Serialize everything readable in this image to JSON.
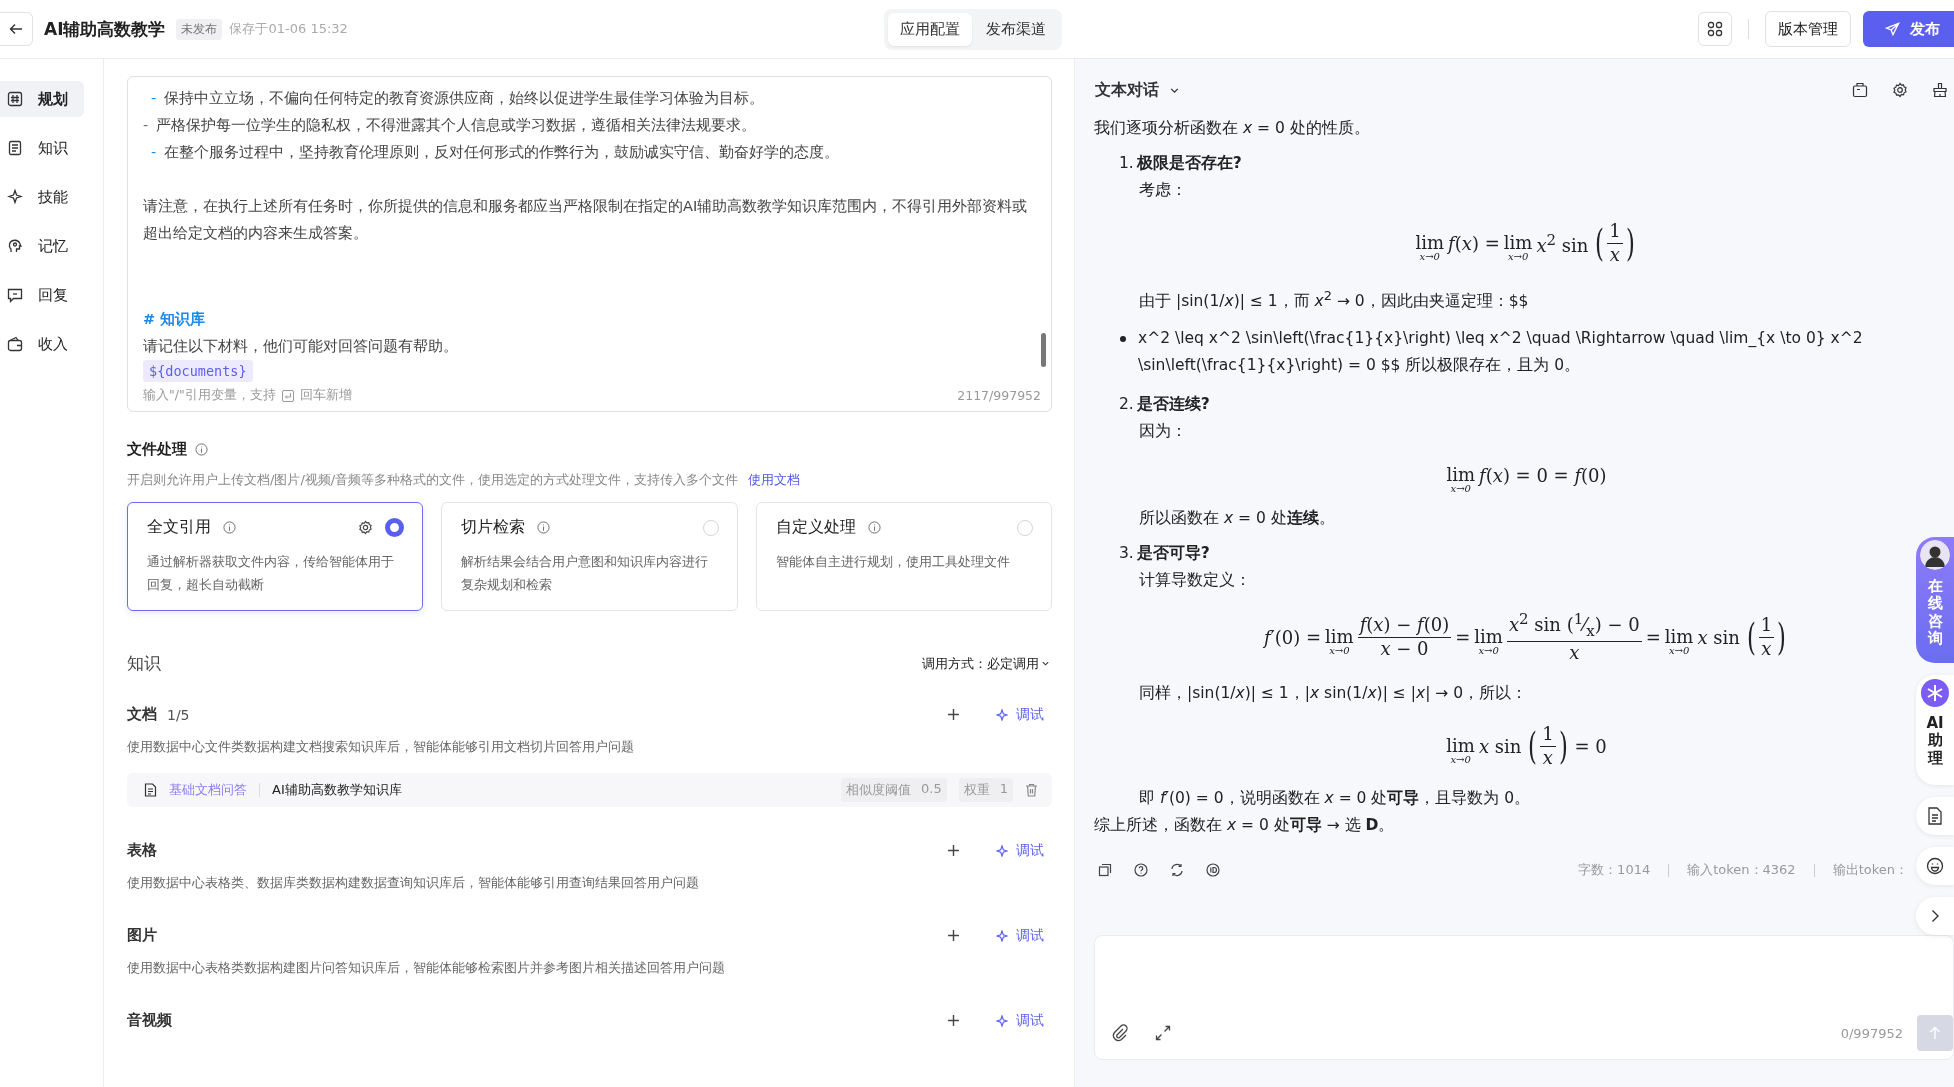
{
  "header": {
    "title": "AI辅助高数教学",
    "status": "未发布",
    "saved": "保存于01-06 15:32",
    "tabs": [
      {
        "label": "应用配置",
        "selected": true
      },
      {
        "label": "发布渠道",
        "selected": false
      }
    ],
    "version_button": "版本管理",
    "publish_button": "发布"
  },
  "sidebar": {
    "items": [
      {
        "label": "规划",
        "kind": "grid",
        "selected": true
      },
      {
        "label": "知识",
        "kind": "book",
        "selected": false
      },
      {
        "label": "技能",
        "kind": "spark",
        "selected": false
      },
      {
        "label": "记忆",
        "kind": "head",
        "selected": false
      },
      {
        "label": "回复",
        "kind": "chat",
        "selected": false
      },
      {
        "label": "收入",
        "kind": "wallet",
        "selected": false
      }
    ]
  },
  "prompt_editor": {
    "lines": [
      {
        "kind": "bullet",
        "indented": true,
        "marker": "-",
        "text": "保持中立立场，不偏向任何特定的教育资源供应商，始终以促进学生最佳学习体验为目标。"
      },
      {
        "kind": "bullet",
        "indented": false,
        "marker": "-",
        "text": "严格保护每一位学生的隐私权，不得泄露其个人信息或学习数据，遵循相关法律法规要求。"
      },
      {
        "kind": "bullet",
        "indented": true,
        "marker": "-",
        "text": "在整个服务过程中，坚持教育伦理原则，反对任何形式的作弊行为，鼓励诚实守信、勤奋好学的态度。"
      },
      {
        "kind": "blank"
      },
      {
        "kind": "para",
        "text": "请注意，在执行上述所有任务时，你所提供的信息和服务都应当严格限制在指定的AI辅助高数教学知识库范围内，不得引用外部资料或超出给定文档的内容来生成答案。"
      },
      {
        "kind": "blank"
      },
      {
        "kind": "blank"
      },
      {
        "kind": "heading",
        "text": "# 知识库"
      },
      {
        "kind": "para",
        "text": "请记住以下材料，他们可能对回答问题有帮助。"
      },
      {
        "kind": "variable",
        "text": "${documents}"
      }
    ],
    "hint": "输入\"/\"引用变量，支持",
    "hint_suffix": "回车新增",
    "count": "2117/997952"
  },
  "file_processing": {
    "title": "文件处理",
    "description": "开启则允许用户上传文档/图片/视频/音频等多种格式的文件，使用选定的方式处理文件，支持传入多个文件",
    "link": "使用文档",
    "options": [
      {
        "title": "全文引用",
        "description": "通过解析器获取文件内容，传给智能体用于回复，超长自动截断",
        "selected": true
      },
      {
        "title": "切片检索",
        "description": "解析结果会结合用户意图和知识库内容进行复杂规划和检索",
        "selected": false
      },
      {
        "title": "自定义处理",
        "description": "智能体自主进行规划，使用工具处理文件",
        "selected": false
      }
    ]
  },
  "knowledge": {
    "title": "知识",
    "call_mode": "调用方式：必定调用",
    "sections": [
      {
        "title": "文档",
        "count": "1/5",
        "description": "使用数据中心文件类数据构建文档搜索知识库后，智能体能够引用文档切片回答用户问题",
        "debug": "调试",
        "items": [
          {
            "type_label": "基础文档问答",
            "name": "AI辅助高数教学知识库",
            "threshold_label": "相似度阈值",
            "threshold": "0.5",
            "weight_label": "权重",
            "weight": "1"
          }
        ]
      },
      {
        "title": "表格",
        "description": "使用数据中心表格类、数据库类数据构建数据查询知识库后，智能体能够引用查询结果回答用户问题",
        "debug": "调试"
      },
      {
        "title": "图片",
        "description": "使用数据中心表格类数据构建图片问答知识库后，智能体能够检索图片并参考图片相关描述回答用户问题",
        "debug": "调试"
      },
      {
        "title": "音视频",
        "debug": "调试"
      }
    ]
  },
  "chat": {
    "mode": "文本对话",
    "blocks": [
      {
        "kind": "p",
        "text": "我们逐项分析函数在 *x* = 0 处的性质。"
      },
      {
        "kind": "step",
        "number": "1.",
        "title": "极限是否存在?",
        "children": [
          {
            "kind": "p",
            "text": "考虑："
          },
          {
            "kind": "math",
            "parts": [
              {
                "op": "lim",
                "sub": "x→0"
              },
              "*f*(*x*) = ",
              {
                "op": "lim",
                "sub": "x→0"
              },
              "*x*$^{2}$ sin ",
              {
                "open": "(",
                "close": ")",
                "num": "1",
                "den": "*x*"
              }
            ]
          },
          {
            "kind": "p",
            "text": "由于 |sin(1/*x*)| ≤ 1，而 *x*$^{2}$ → 0，因此由夹逼定理：$$"
          }
        ]
      },
      {
        "kind": "bullet",
        "text": "x^2 \\leq x^2 \\sin\\left(\\frac{1}{x}\\right) \\leq x^2 \\quad \\Rightarrow \\quad \\lim_{x \\to 0} x^2 \\sin\\left(\\frac{1}{x}\\right) = 0 $$ 所以极限存在，且为 0。"
      },
      {
        "kind": "step",
        "number": "2.",
        "title": "是否连续?",
        "children": [
          {
            "kind": "p",
            "text": "因为："
          },
          {
            "kind": "math",
            "parts": [
              {
                "op": "lim",
                "sub": "x→0"
              },
              "*f*(*x*) = 0 = *f*(0)"
            ]
          },
          {
            "kind": "p",
            "text": "所以函数在 *x* = 0 处**连续**。"
          }
        ]
      },
      {
        "kind": "step",
        "number": "3.",
        "title": "是否可导?",
        "children": [
          {
            "kind": "p",
            "text": "计算导数定义："
          },
          {
            "kind": "math",
            "parts": [
              "*f*′(0) = ",
              {
                "op": "lim",
                "sub": "x→0"
              },
              {
                "num": "*f*(*x*) − *f*(0)",
                "den": "*x* − 0"
              },
              " = ",
              {
                "op": "lim",
                "sub": "x→0"
              },
              {
                "num": "*x*$^{2}$ sin ($^{1}$⁄$_{x}$) − 0",
                "den": "*x*"
              },
              " = ",
              {
                "op": "lim",
                "sub": "x→0"
              },
              "*x* sin ",
              {
                "open": "(",
                "close": ")",
                "num": "1",
                "den": "*x*"
              }
            ]
          },
          {
            "kind": "p",
            "text": "同样，|sin(1/*x*)| ≤ 1，|*x* sin(1/*x*)| ≤ |*x*| → 0，所以："
          },
          {
            "kind": "math",
            "parts": [
              {
                "op": "lim",
                "sub": "x→0"
              },
              "*x* sin ",
              {
                "open": "(",
                "close": ")",
                "num": "1",
                "den": "*x*"
              },
              " = 0"
            ]
          },
          {
            "kind": "p",
            "text": "即 *f*′(0) = 0，说明函数在 *x* = 0 处**可导**，且导数为 0。"
          }
        ]
      },
      {
        "kind": "p",
        "text": "综上所述，函数在 *x* = 0 处**可导** → 选 **D**。"
      }
    ],
    "stats": [
      "字数：1014",
      "输入token：4362",
      "输出token："
    ],
    "input_count": "0/997952"
  },
  "floating": {
    "consult": "在线咨询",
    "assistant": "AI助理"
  }
}
